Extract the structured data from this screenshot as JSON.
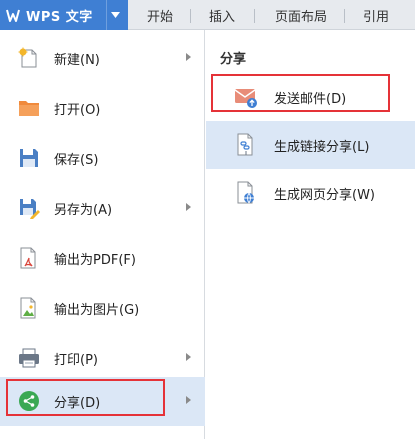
{
  "app": {
    "title": "WPS 文字",
    "accent": "#3f7fd3"
  },
  "ribbon_tabs": [
    {
      "label": "开始"
    },
    {
      "label": "插入"
    },
    {
      "label": "页面布局"
    },
    {
      "label": "引用"
    }
  ],
  "file_menu": {
    "items": [
      {
        "label": "新建(N)",
        "icon": "new-document-icon",
        "has_submenu": true
      },
      {
        "label": "打开(O)",
        "icon": "folder-icon",
        "has_submenu": false
      },
      {
        "label": "保存(S)",
        "icon": "save-disk-icon",
        "has_submenu": false
      },
      {
        "label": "另存为(A)",
        "icon": "save-as-icon",
        "has_submenu": true
      },
      {
        "label": "输出为PDF(F)",
        "icon": "pdf-export-icon",
        "has_submenu": false
      },
      {
        "label": "输出为图片(G)",
        "icon": "image-export-icon",
        "has_submenu": false
      },
      {
        "label": "打印(P)",
        "icon": "printer-icon",
        "has_submenu": true
      },
      {
        "label": "分享(D)",
        "icon": "share-icon",
        "has_submenu": true,
        "selected": true
      }
    ]
  },
  "share_panel": {
    "title": "分享",
    "items": [
      {
        "label": "发送邮件(D)",
        "icon": "email-send-icon"
      },
      {
        "label": "生成链接分享(L)",
        "icon": "link-share-icon",
        "selected": true
      },
      {
        "label": "生成网页分享(W)",
        "icon": "web-share-icon"
      }
    ]
  },
  "colors": {
    "highlight": "#dbe7f6",
    "annotation_box": "#e53238"
  }
}
